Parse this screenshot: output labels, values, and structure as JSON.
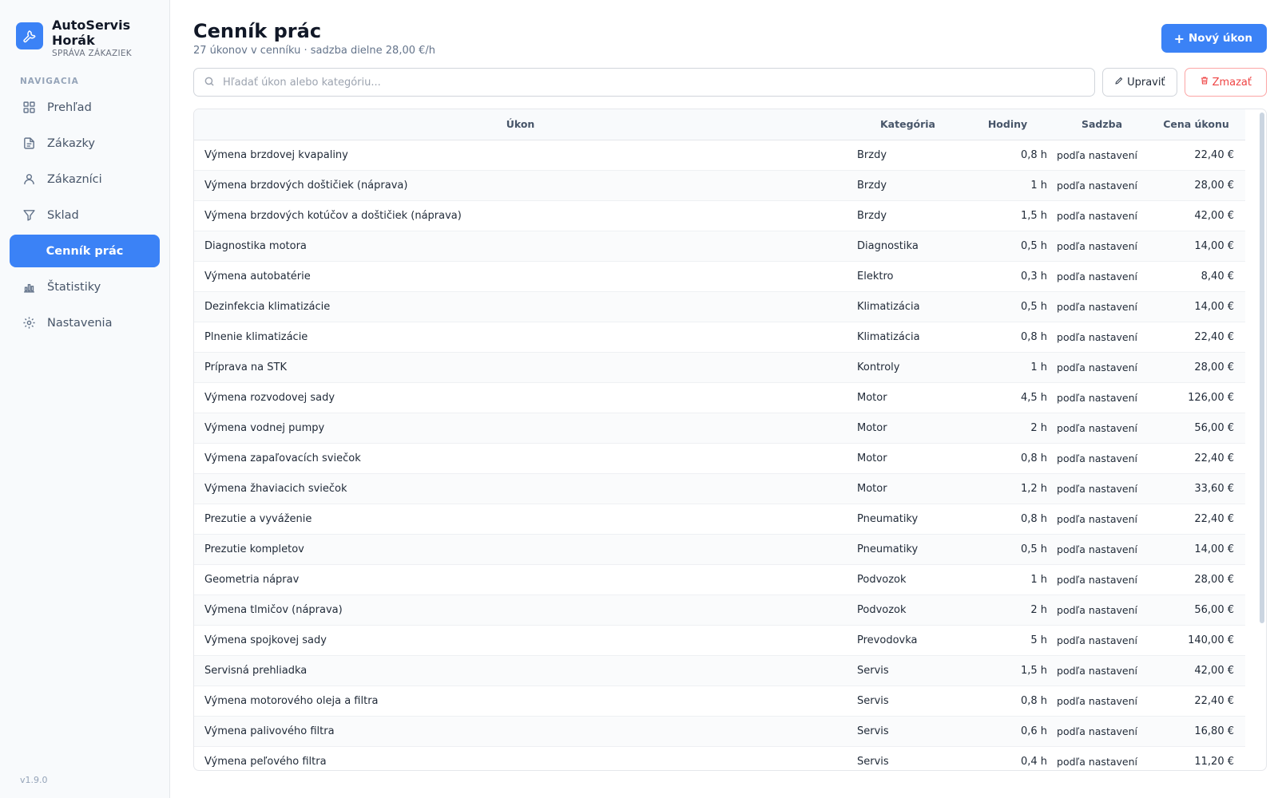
{
  "brand": {
    "name": "AutoServis Horák",
    "subtitle": "SPRÁVA ZÁKAZIEK",
    "icon": "wrench-icon"
  },
  "nav": {
    "title": "NAVIGACIA",
    "items": [
      {
        "label": "Prehľad",
        "icon": "grid-icon"
      },
      {
        "label": "Zákazky",
        "icon": "document-icon"
      },
      {
        "label": "Zákazníci",
        "icon": "user-icon"
      },
      {
        "label": "Sklad",
        "icon": "filter-icon"
      },
      {
        "label": "Cenník prác",
        "icon": "",
        "active": true
      },
      {
        "label": "Štatistiky",
        "icon": "bar-chart-icon"
      },
      {
        "label": "Nastavenia",
        "icon": "gear-icon"
      }
    ]
  },
  "version": "v1.9.0",
  "header": {
    "title": "Cenník prác",
    "subtitle": "27 úkonov v cenníku · sadzba dielne 28,00 €/h",
    "new_button": "Nový úkon"
  },
  "toolbar": {
    "search_placeholder": "Hľadať úkon alebo kategóriu...",
    "search_value": "",
    "edit_button": "Upraviť",
    "delete_button": "Zmazať"
  },
  "table": {
    "columns": [
      "Úkon",
      "Kategória",
      "Hodiny",
      "Sadzba",
      "Cena úkonu"
    ],
    "rows": [
      [
        "Výmena brzdovej kvapaliny",
        "Brzdy",
        "0,8 h",
        "podľa nastavení",
        "22,40 €"
      ],
      [
        "Výmena brzdových doštičiek (náprava)",
        "Brzdy",
        "1 h",
        "podľa nastavení",
        "28,00 €"
      ],
      [
        "Výmena brzdových kotúčov a doštičiek (náprava)",
        "Brzdy",
        "1,5 h",
        "podľa nastavení",
        "42,00 €"
      ],
      [
        "Diagnostika motora",
        "Diagnostika",
        "0,5 h",
        "podľa nastavení",
        "14,00 €"
      ],
      [
        "Výmena autobatérie",
        "Elektro",
        "0,3 h",
        "podľa nastavení",
        "8,40 €"
      ],
      [
        "Dezinfekcia klimatizácie",
        "Klimatizácia",
        "0,5 h",
        "podľa nastavení",
        "14,00 €"
      ],
      [
        "Plnenie klimatizácie",
        "Klimatizácia",
        "0,8 h",
        "podľa nastavení",
        "22,40 €"
      ],
      [
        "Príprava na STK",
        "Kontroly",
        "1 h",
        "podľa nastavení",
        "28,00 €"
      ],
      [
        "Výmena rozvodovej sady",
        "Motor",
        "4,5 h",
        "podľa nastavení",
        "126,00 €"
      ],
      [
        "Výmena vodnej pumpy",
        "Motor",
        "2 h",
        "podľa nastavení",
        "56,00 €"
      ],
      [
        "Výmena zapaľovacích sviečok",
        "Motor",
        "0,8 h",
        "podľa nastavení",
        "22,40 €"
      ],
      [
        "Výmena žhaviacich sviečok",
        "Motor",
        "1,2 h",
        "podľa nastavení",
        "33,60 €"
      ],
      [
        "Prezutie a vyváženie",
        "Pneumatiky",
        "0,8 h",
        "podľa nastavení",
        "22,40 €"
      ],
      [
        "Prezutie kompletov",
        "Pneumatiky",
        "0,5 h",
        "podľa nastavení",
        "14,00 €"
      ],
      [
        "Geometria náprav",
        "Podvozok",
        "1 h",
        "podľa nastavení",
        "28,00 €"
      ],
      [
        "Výmena tlmičov (náprava)",
        "Podvozok",
        "2 h",
        "podľa nastavení",
        "56,00 €"
      ],
      [
        "Výmena spojkovej sady",
        "Prevodovka",
        "5 h",
        "podľa nastavení",
        "140,00 €"
      ],
      [
        "Servisná prehliadka",
        "Servis",
        "1,5 h",
        "podľa nastavení",
        "42,00 €"
      ],
      [
        "Výmena motorového oleja a filtra",
        "Servis",
        "0,8 h",
        "podľa nastavení",
        "22,40 €"
      ],
      [
        "Výmena palivového filtra",
        "Servis",
        "0,6 h",
        "podľa nastavení",
        "16,80 €"
      ],
      [
        "Výmena peľového filtra",
        "Servis",
        "0,4 h",
        "podľa nastavení",
        "11,20 €"
      ]
    ]
  },
  "colors": {
    "accent": "#3b82f6",
    "danger": "#ef4444"
  }
}
